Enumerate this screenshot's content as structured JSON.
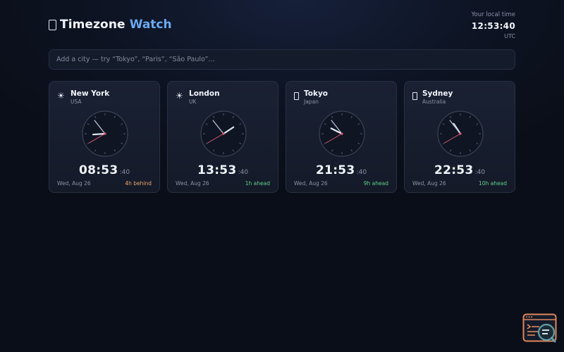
{
  "header": {
    "title": "Timezone",
    "title_accent": "Watch",
    "app_icon": "window-icon",
    "local_label": "Your local time",
    "local_time": "12:53:40",
    "local_zone": "UTC"
  },
  "search": {
    "value": "",
    "placeholder": "Add a city — try “Tokyo”, “Paris”, “São Paulo”…"
  },
  "cities": [
    {
      "city": "New York",
      "country": "USA",
      "icon": "sun-icon",
      "time": "08:53",
      "seconds": ":40",
      "date": "Wed, Aug 26",
      "offset": "4h behind",
      "offset_color": "#f0a46a",
      "hour": 8,
      "minute": 53,
      "second": 40
    },
    {
      "city": "London",
      "country": "UK",
      "icon": "sun-icon",
      "time": "13:53",
      "seconds": ":40",
      "date": "Wed, Aug 26",
      "offset": "1h ahead",
      "offset_color": "#5fd08a",
      "hour": 13,
      "minute": 53,
      "second": 40
    },
    {
      "city": "Tokyo",
      "country": "Japan",
      "icon": "moon-icon",
      "time": "21:53",
      "seconds": ":40",
      "date": "Wed, Aug 26",
      "offset": "9h ahead",
      "offset_color": "#5fd08a",
      "hour": 21,
      "minute": 53,
      "second": 40
    },
    {
      "city": "Sydney",
      "country": "Australia",
      "icon": "moon-icon",
      "time": "22:53",
      "seconds": ":40",
      "date": "Wed, Aug 26",
      "offset": "10h ahead",
      "offset_color": "#5fd08a",
      "hour": 22,
      "minute": 53,
      "second": 40
    }
  ],
  "colors": {
    "accent": "#6aa9f0",
    "hour_hand": "#e6ebf5",
    "second_hand": "#e05a6e",
    "behind": "#f0a46a",
    "ahead": "#5fd08a"
  }
}
